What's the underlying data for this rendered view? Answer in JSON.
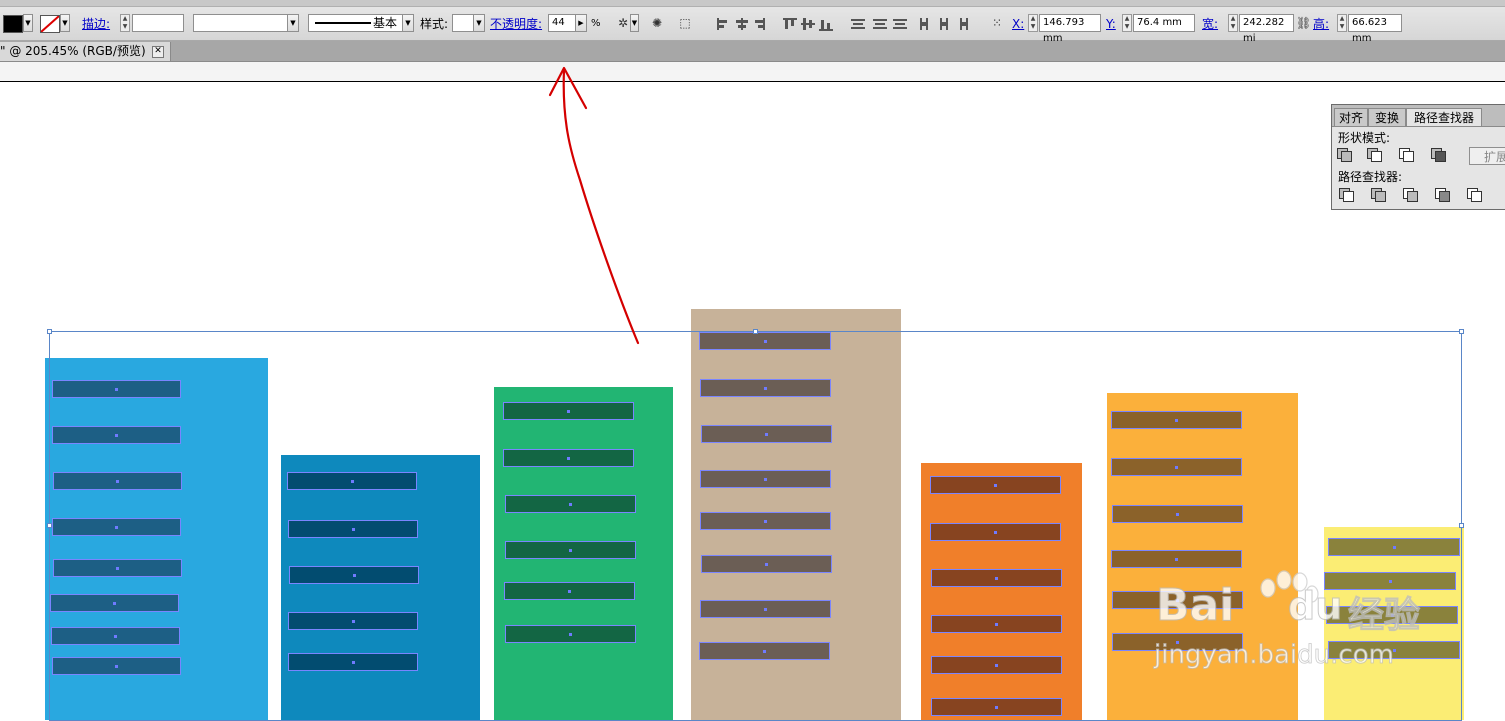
{
  "toolbar": {
    "stroke_label": "描边:",
    "brush_style": "基本",
    "style_label": "样式:",
    "opacity_label": "不透明度:",
    "opacity_value": "44",
    "percent": "%",
    "x_label": "X:",
    "x_value": "146.793 mm",
    "y_label": "Y:",
    "y_value": "76.4 mm",
    "w_label": "宽:",
    "w_value": "242.282 mi",
    "h_label": "高:",
    "h_value": "66.623 mm"
  },
  "document_tab": {
    "title": "\" @ 205.45% (RGB/预览)",
    "close": "✕"
  },
  "panel": {
    "tabs": [
      "对齐",
      "变换",
      "路径查找器"
    ],
    "active_tab": "路径查找器",
    "shape_modes_label": "形状模式:",
    "pathfinders_label": "路径查找器:",
    "expand_button": "扩展"
  },
  "watermark": {
    "brand": "Bai",
    "brand_tail": "du",
    "brand_cn": "经验",
    "url": "jingyan.baidu.com"
  },
  "colors": {
    "building_blue": "#29a8e0",
    "building_blue_dark": "#0e89bd",
    "building_green": "#22b573",
    "building_tan": "#c7b299",
    "building_orange": "#f07f2a",
    "building_amber": "#fbb03b",
    "building_yellow": "#fbed74",
    "arrow": "#d40000",
    "selection": "#5a86c8"
  }
}
